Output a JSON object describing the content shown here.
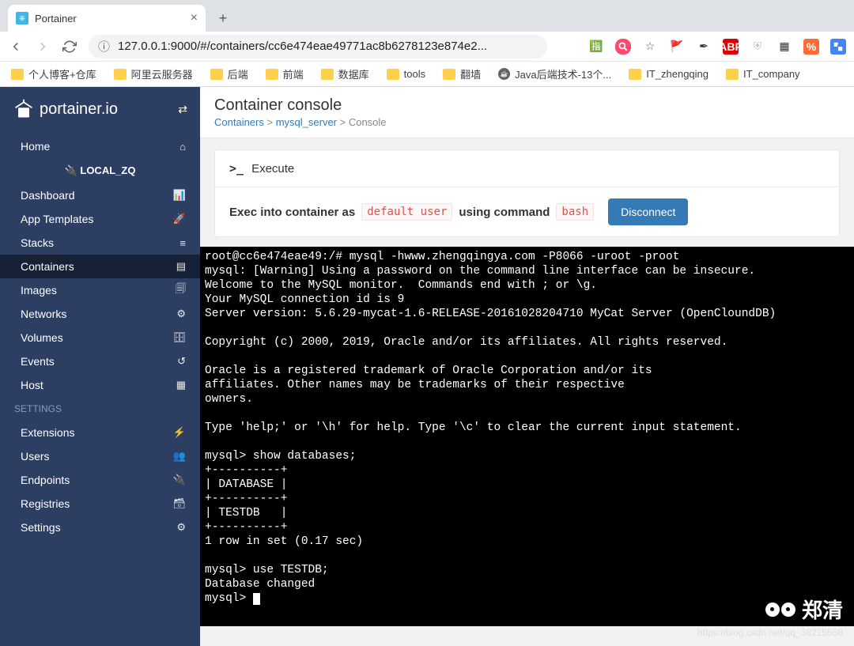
{
  "browser": {
    "tab_title": "Portainer",
    "url": "127.0.0.1:9000/#/containers/cc6e474eae49771ac8b6278123e874e2...",
    "bookmarks": [
      {
        "label": "个人博客+仓库",
        "type": "folder"
      },
      {
        "label": "阿里云服务器",
        "type": "folder"
      },
      {
        "label": "后端",
        "type": "folder"
      },
      {
        "label": "前端",
        "type": "folder"
      },
      {
        "label": "数据库",
        "type": "folder"
      },
      {
        "label": "tools",
        "type": "folder"
      },
      {
        "label": "翻墙",
        "type": "folder"
      },
      {
        "label": "Java后端技术-13个...",
        "type": "page"
      },
      {
        "label": "IT_zhengqing",
        "type": "folder"
      },
      {
        "label": "IT_company",
        "type": "folder"
      }
    ]
  },
  "sidebar": {
    "brand": "portainer.io",
    "home": "Home",
    "env": "LOCAL_ZQ",
    "items": [
      {
        "label": "Dashboard",
        "icon": "dashboard"
      },
      {
        "label": "App Templates",
        "icon": "template"
      },
      {
        "label": "Stacks",
        "icon": "stacks"
      },
      {
        "label": "Containers",
        "icon": "containers",
        "active": true
      },
      {
        "label": "Images",
        "icon": "images"
      },
      {
        "label": "Networks",
        "icon": "networks"
      },
      {
        "label": "Volumes",
        "icon": "volumes"
      },
      {
        "label": "Events",
        "icon": "events"
      },
      {
        "label": "Host",
        "icon": "host"
      }
    ],
    "section": "SETTINGS",
    "settings_items": [
      {
        "label": "Extensions",
        "icon": "ext"
      },
      {
        "label": "Users",
        "icon": "users"
      },
      {
        "label": "Endpoints",
        "icon": "endpoints"
      },
      {
        "label": "Registries",
        "icon": "registries"
      },
      {
        "label": "Settings",
        "icon": "settings"
      }
    ]
  },
  "page": {
    "title": "Container console",
    "crumb1": "Containers",
    "crumb2": "mysql_server",
    "crumb3": "Console",
    "execute": "Execute",
    "exec_prefix": "Exec into container as",
    "exec_user": "default user",
    "exec_mid": "using command",
    "exec_cmd": "bash",
    "disconnect": "Disconnect"
  },
  "terminal": "root@cc6e474eae49:/# mysql -hwww.zhengqingya.com -P8066 -uroot -proot\nmysql: [Warning] Using a password on the command line interface can be insecure.\nWelcome to the MySQL monitor.  Commands end with ; or \\g.\nYour MySQL connection id is 9\nServer version: 5.6.29-mycat-1.6-RELEASE-20161028204710 MyCat Server (OpenCloundDB)\n\nCopyright (c) 2000, 2019, Oracle and/or its affiliates. All rights reserved.\n\nOracle is a registered trademark of Oracle Corporation and/or its\naffiliates. Other names may be trademarks of their respective\nowners.\n\nType 'help;' or '\\h' for help. Type '\\c' to clear the current input statement.\n\nmysql> show databases;\n+----------+\n| DATABASE |\n+----------+\n| TESTDB   |\n+----------+\n1 row in set (0.17 sec)\n\nmysql> use TESTDB;\nDatabase changed\nmysql> ",
  "watermark": {
    "name": "郑清",
    "url": "https://blog.csdn.net/qq_38225558"
  }
}
